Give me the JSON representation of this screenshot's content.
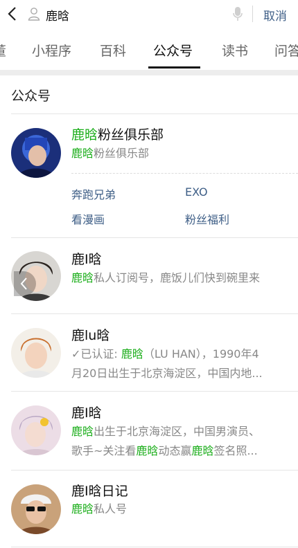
{
  "search": {
    "query": "鹿晗",
    "cancel_label": "取消"
  },
  "tabs": [
    "董",
    "小程序",
    "百科",
    "公众号",
    "读书",
    "问答"
  ],
  "section_title": "公众号",
  "accounts": [
    {
      "name_hl": "鹿晗",
      "name_rest": "粉丝俱乐部",
      "desc_hl": "鹿晗",
      "desc_rest": "粉丝俱乐部",
      "links": [
        "奔跑兄弟",
        "EXO",
        "看漫画",
        "粉丝福利"
      ]
    },
    {
      "name": "鹿I晗",
      "desc_hl": "鹿晗",
      "desc_rest": "私人订阅号，鹿饭儿们快到碗里来"
    },
    {
      "name": "鹿lu晗",
      "line1_pre": "✓已认证: ",
      "line1_hl": "鹿晗",
      "line1_rest": "（LU HAN），1990年4",
      "line2": "月20日出生于北京海淀区，中国内地..."
    },
    {
      "name": "鹿I晗",
      "line1_hl": "鹿晗",
      "line1_rest": "出生于北京海淀区，中国男演员、",
      "line2_pre": "歌手~关注看",
      "line2_hl1": "鹿晗",
      "line2_mid": "动态赢",
      "line2_hl2": "鹿晗",
      "line2_rest": "签名照..."
    },
    {
      "name": "鹿I晗日记",
      "desc_hl": "鹿晗",
      "desc_rest": "私人号"
    }
  ],
  "colors": {
    "highlight": "#1aad19",
    "link": "#3f5f87"
  }
}
